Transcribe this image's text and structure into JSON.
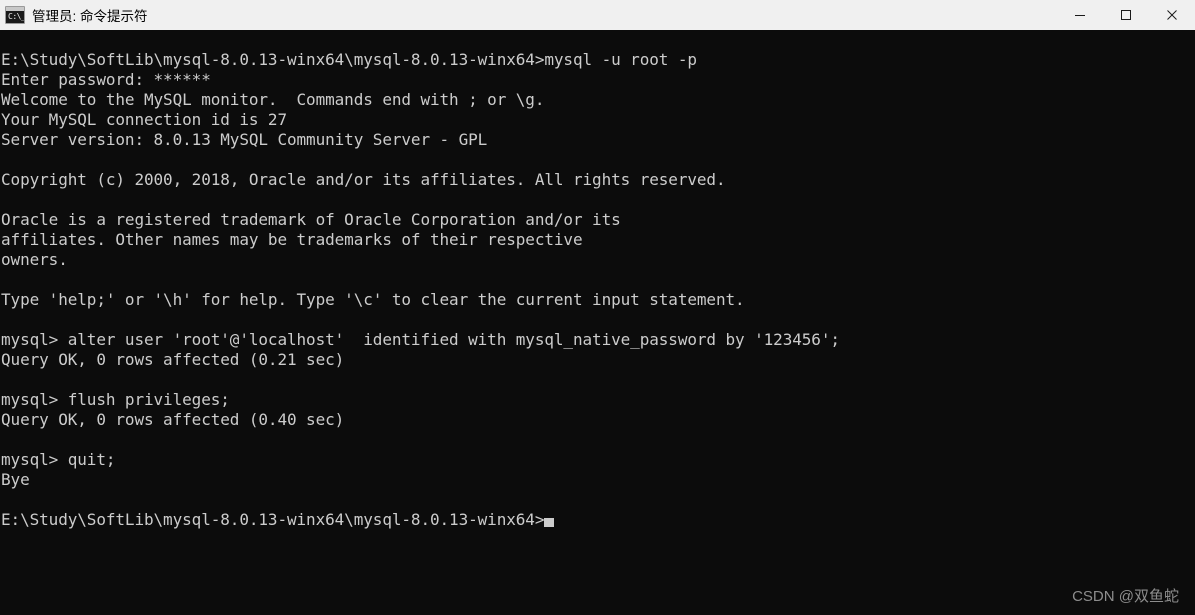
{
  "window": {
    "title": "管理员: 命令提示符",
    "icon": "cmd-console-icon",
    "icon_glyph": "C:\\_",
    "titlebar_bg": "#f0f0f0",
    "titlebar_fg": "#000000",
    "terminal_bg": "#0c0c0c",
    "terminal_fg": "#cccccc"
  },
  "titlebar_buttons": {
    "minimize": {
      "name": "minimize-button",
      "glyph": "—"
    },
    "maximize": {
      "name": "maximize-button",
      "glyph": "□"
    },
    "close": {
      "name": "close-button",
      "glyph": "✕"
    }
  },
  "terminal": {
    "cursor": "block-underscore",
    "lines": [
      "E:\\Study\\SoftLib\\mysql-8.0.13-winx64\\mysql-8.0.13-winx64>mysql -u root -p",
      "Enter password: ******",
      "Welcome to the MySQL monitor.  Commands end with ; or \\g.",
      "Your MySQL connection id is 27",
      "Server version: 8.0.13 MySQL Community Server - GPL",
      "",
      "Copyright (c) 2000, 2018, Oracle and/or its affiliates. All rights reserved.",
      "",
      "Oracle is a registered trademark of Oracle Corporation and/or its",
      "affiliates. Other names may be trademarks of their respective",
      "owners.",
      "",
      "Type 'help;' or '\\h' for help. Type '\\c' to clear the current input statement.",
      "",
      "mysql> alter user 'root'@'localhost'  identified with mysql_native_password by '123456';",
      "Query OK, 0 rows affected (0.21 sec)",
      "",
      "mysql> flush privileges;",
      "Query OK, 0 rows affected (0.40 sec)",
      "",
      "mysql> quit;",
      "Bye",
      "",
      "E:\\Study\\SoftLib\\mysql-8.0.13-winx64\\mysql-8.0.13-winx64>"
    ],
    "cursor_line_index": 23
  },
  "watermark": {
    "text": "CSDN @双鱼蛇",
    "color": "#8d8d8d"
  }
}
